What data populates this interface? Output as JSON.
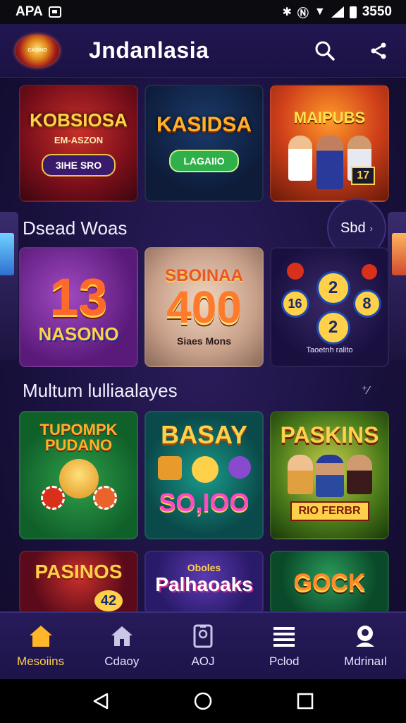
{
  "status_bar": {
    "left_text": "APA",
    "right_text": "3550"
  },
  "header": {
    "logo_text": "CASINO",
    "title": "Jndanlasia"
  },
  "featured": [
    {
      "title": "KOBSIOSA",
      "subtitle": "EM-ASZON",
      "pill": "3IHE SRO"
    },
    {
      "title": "KASIDSA",
      "pill": "LAGAIIO"
    },
    {
      "title": "MAIPUBS",
      "badge": "17"
    }
  ],
  "section1": {
    "title": "Dsead Woas",
    "see_all": "Sbd"
  },
  "row1": [
    {
      "big": "13",
      "title": "NASONO"
    },
    {
      "title": "SBOINAA",
      "big": "400",
      "sub": "Siaes Mons"
    },
    {
      "chips": [
        "16",
        "2",
        "8",
        "2"
      ],
      "sub": "Taoetnh ralito"
    }
  ],
  "section2": {
    "title": "Multum lulliaalayes"
  },
  "row2": [
    {
      "title": "TUPOMPK PUDANO"
    },
    {
      "title": "BASAY",
      "big": "SO,IOO"
    },
    {
      "title": "PASKINS",
      "banner": "RIO FERBR"
    }
  ],
  "row3": [
    {
      "title": "PASINOS",
      "badge": "42"
    },
    {
      "title": "Palhaoaks",
      "sub": "Oboles"
    },
    {
      "title": "GOCK"
    }
  ],
  "bottom_nav": [
    {
      "label": "Mesoiins",
      "icon": "home-icon",
      "active": true
    },
    {
      "label": "Cdaoy",
      "icon": "home-outline-icon"
    },
    {
      "label": "AOJ",
      "icon": "tablet-icon"
    },
    {
      "label": "Pclod",
      "icon": "list-icon"
    },
    {
      "label": "Mdrinaıl",
      "icon": "profile-icon"
    }
  ],
  "colors": {
    "accent": "#ffb629",
    "background": "#1a1240",
    "header": "#221651"
  }
}
